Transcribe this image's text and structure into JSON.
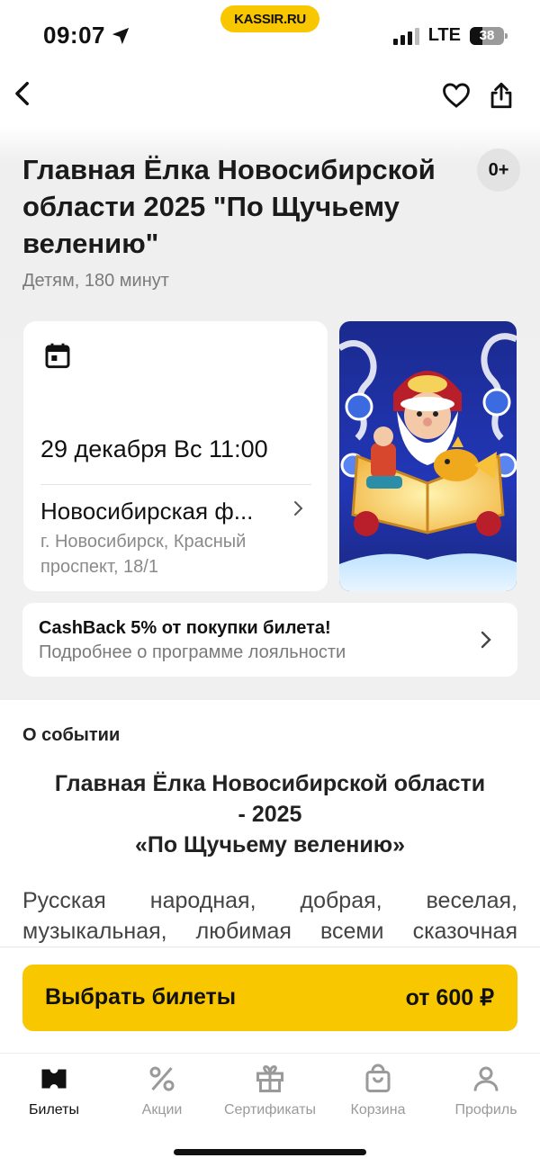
{
  "status": {
    "time": "09:07",
    "network": "LTE",
    "battery": "38",
    "battery_level": 0.38,
    "brand_pill": "KASSIR.RU"
  },
  "event": {
    "title": "Главная Ёлка Новосибирской области 2025 \"По Щучьему велению\"",
    "subtitle": "Детям, 180 минут",
    "age": "0+"
  },
  "info_card": {
    "date": "29 декабря Вс 11:00",
    "venue": "Новосибирская ф...",
    "address": "г. Новосибирск, Красный проспект, 18/1"
  },
  "cashback": {
    "title": "CashBack 5% от покупки билета!",
    "subtitle": "Подробнее о программе лояльности"
  },
  "about": {
    "label": "О событии",
    "heading_line1": "Главная Ёлка Новосибирской области",
    "heading_line2": "- 2025",
    "heading_line3": "«По Щучьему велению»",
    "text": "Русская народная, добрая, веселая, музыкальная, любимая всеми сказочная"
  },
  "cta": {
    "label": "Выбрать билеты",
    "price": "от 600 ₽"
  },
  "tabs": [
    {
      "label": "Билеты",
      "icon": "ticket-icon",
      "active": true
    },
    {
      "label": "Акции",
      "icon": "percent-icon",
      "active": false
    },
    {
      "label": "Сертификаты",
      "icon": "gift-icon",
      "active": false
    },
    {
      "label": "Корзина",
      "icon": "bag-icon",
      "active": false
    },
    {
      "label": "Профиль",
      "icon": "profile-icon",
      "active": false
    }
  ],
  "colors": {
    "accent": "#f9c700",
    "background_top": "#f0f0f0",
    "text_secondary": "#7a7a7a"
  }
}
